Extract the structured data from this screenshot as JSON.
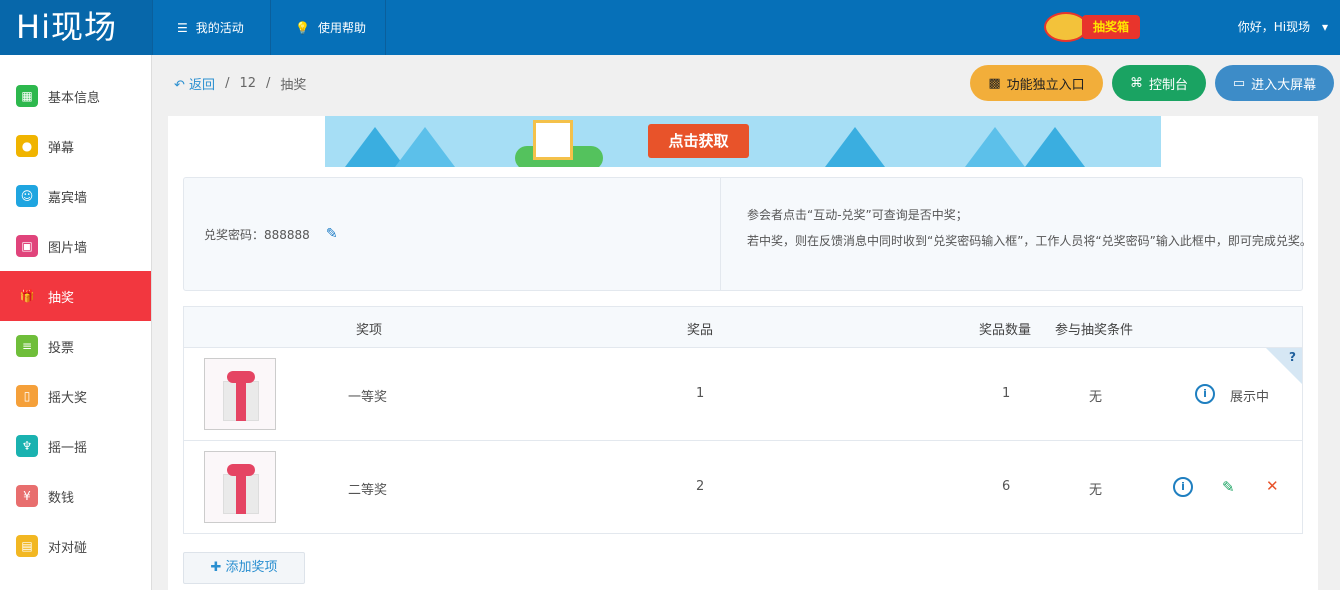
{
  "header": {
    "logo": "Hi现场",
    "nav": [
      {
        "icon": "list-icon",
        "label": "我的活动"
      },
      {
        "icon": "bulb-icon",
        "label": "使用帮助"
      }
    ],
    "prize_box_label": "抽奖箱",
    "greeting": "你好，Hi现场"
  },
  "sidebar": {
    "items": [
      {
        "label": "基本信息",
        "icon": "grid-icon",
        "color": "#2db84d"
      },
      {
        "label": "弹幕",
        "icon": "chat-icon",
        "color": "#f0b400"
      },
      {
        "label": "嘉宾墙",
        "icon": "user-icon",
        "color": "#1fa5e0"
      },
      {
        "label": "图片墙",
        "icon": "image-icon",
        "color": "#e0447b"
      },
      {
        "label": "抽奖",
        "icon": "gift-icon",
        "color": "#f2373f",
        "active": true
      },
      {
        "label": "投票",
        "icon": "vote-icon",
        "color": "#6fbe3a"
      },
      {
        "label": "摇大奖",
        "icon": "shake-icon",
        "color": "#f5a03a"
      },
      {
        "label": "摇一摇",
        "icon": "shirt-icon",
        "color": "#1ab2b0"
      },
      {
        "label": "数钱",
        "icon": "yen-icon",
        "color": "#e86e6e"
      },
      {
        "label": "对对碰",
        "icon": "match-icon",
        "color": "#f2b722"
      }
    ]
  },
  "breadcrumb": {
    "back": "返回",
    "id": "12",
    "current": "抽奖",
    "sep": "/"
  },
  "toolbar": {
    "func_entry": "功能独立入口",
    "console": "控制台",
    "big_screen": "进入大屏幕"
  },
  "banner": {
    "button": "点击获取"
  },
  "info": {
    "code_label": "兑奖密码：888888",
    "line1": "参会者点击“互动-兑奖”可查询是否中奖；",
    "line2": "若中奖，则在反馈消息中同时收到“兑奖密码输入框”，工作人员将“兑奖密码”输入此框中，即可完成兑奖。"
  },
  "table": {
    "headers": [
      "奖项",
      "奖品",
      "奖品数量",
      "参与抽奖条件"
    ],
    "rows": [
      {
        "award": "一等奖",
        "prize": "1",
        "quantity": "1",
        "condition": "无",
        "status": "展示中"
      },
      {
        "award": "二等奖",
        "prize": "2",
        "quantity": "6",
        "condition": "无",
        "status": ""
      }
    ],
    "help_mark": "?"
  },
  "add_button": "添加奖项",
  "colors": {
    "topbar": "#0670b8",
    "active": "#f2373f",
    "func": "#f2ae3a",
    "console": "#1aa362",
    "screen": "#3d8cc8"
  }
}
